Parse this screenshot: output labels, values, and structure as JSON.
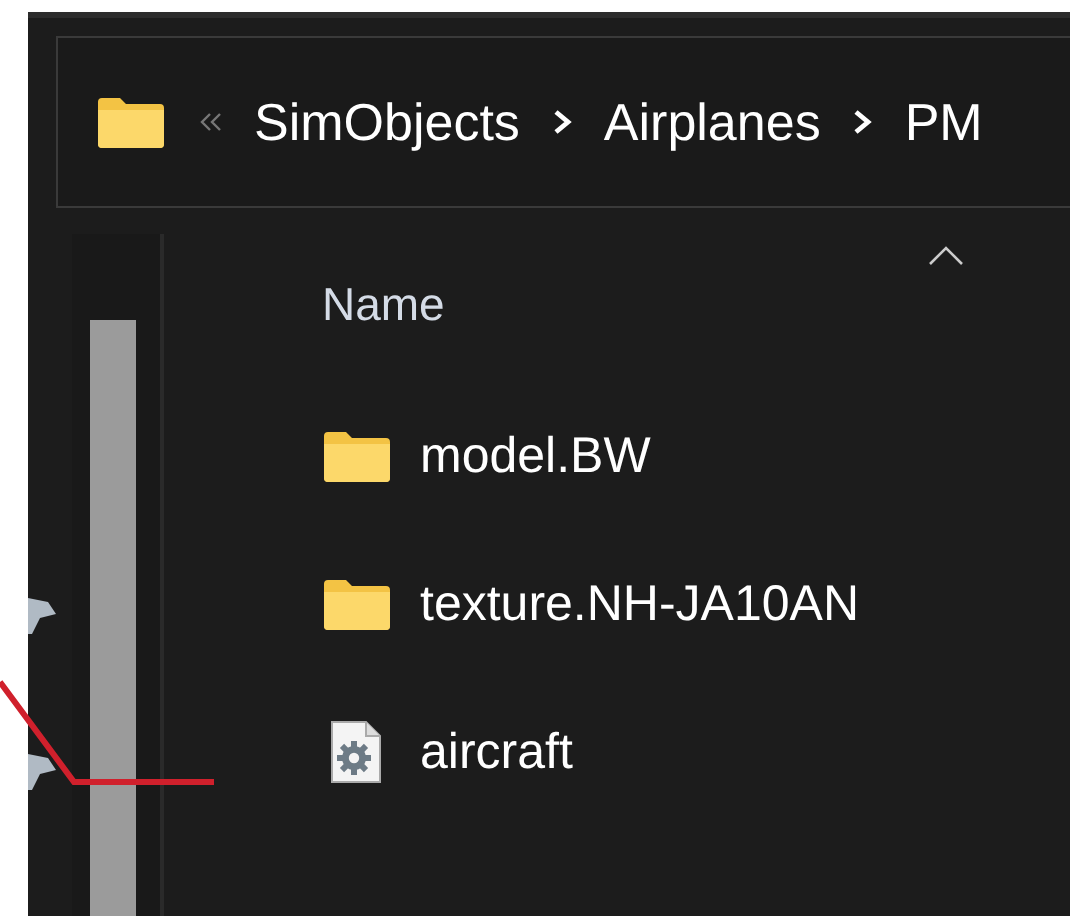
{
  "address_bar": {
    "path": [
      "SimObjects",
      "Airplanes",
      "PM"
    ]
  },
  "nav_pane": {
    "items": [
      {
        "pinned": true
      },
      {
        "pinned": true
      }
    ]
  },
  "file_list": {
    "columns": [
      "Name"
    ],
    "rows": [
      {
        "name": "model.BW",
        "kind": "folder"
      },
      {
        "name": "texture.NH-JA10AN",
        "kind": "folder"
      },
      {
        "name": "aircraft",
        "kind": "file"
      }
    ]
  }
}
